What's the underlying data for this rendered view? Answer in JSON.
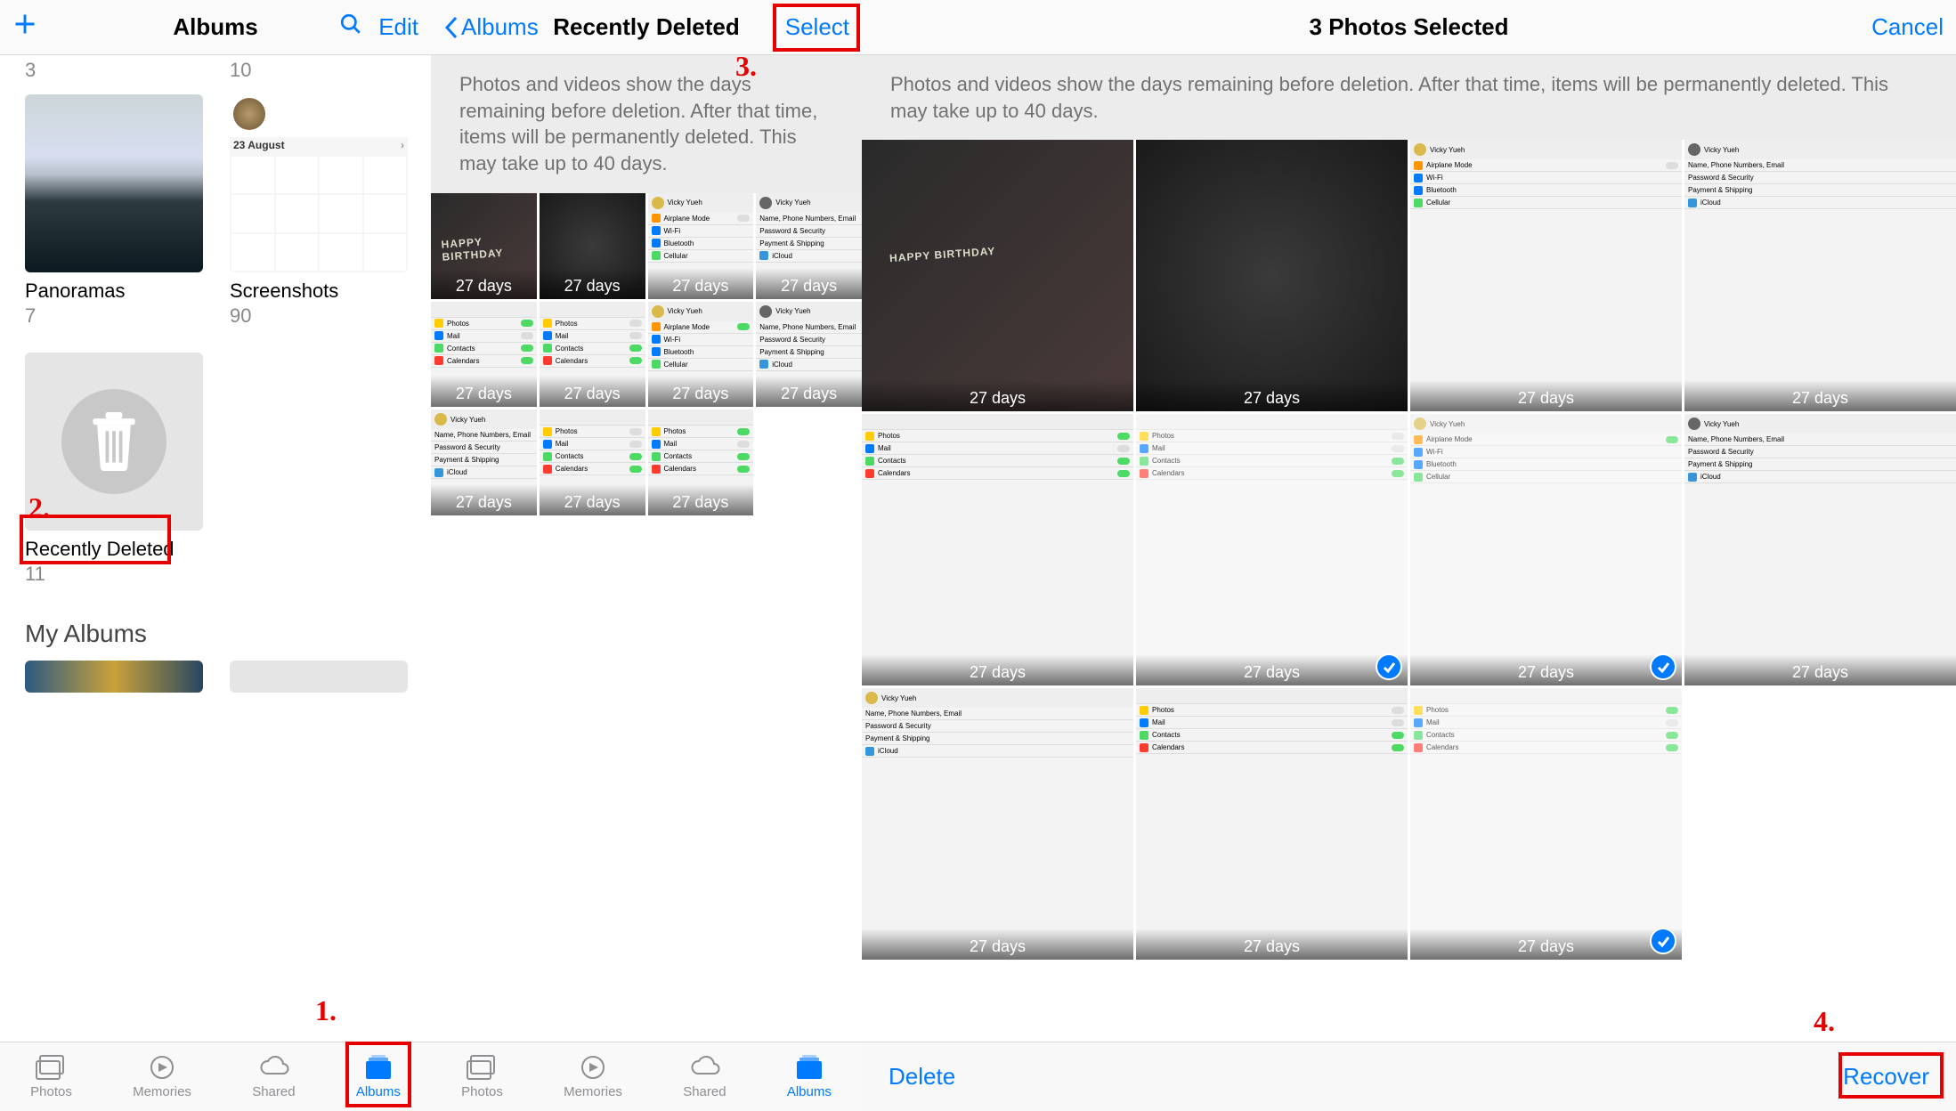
{
  "annotations": {
    "step1": "1.",
    "step2": "2.",
    "step3": "3.",
    "step4": "4."
  },
  "screen1": {
    "nav_title": "Albums",
    "edit": "Edit",
    "top_count_left": "3",
    "top_count_right": "10",
    "ss_date": "23 August",
    "albums": {
      "panoramas": {
        "name": "Panoramas",
        "count": "7"
      },
      "screenshots": {
        "name": "Screenshots",
        "count": "90"
      },
      "recently_deleted": {
        "name": "Recently Deleted",
        "count": "11"
      }
    },
    "section_my_albums": "My Albums",
    "tabs": {
      "photos": "Photos",
      "memories": "Memories",
      "shared": "Shared",
      "albums": "Albums"
    }
  },
  "screen2": {
    "back_label": "Albums",
    "nav_title": "Recently Deleted",
    "select": "Select",
    "info": "Photos and videos show the days remaining before deletion. After that time, items will be permanently deleted. This may take up to 40 days.",
    "days": "27 days",
    "user_name": "Vicky Yueh",
    "tabs": {
      "photos": "Photos",
      "memories": "Memories",
      "shared": "Shared",
      "albums": "Albums"
    }
  },
  "screen3": {
    "nav_title": "3 Photos Selected",
    "cancel": "Cancel",
    "info": "Photos and videos show the days remaining before deletion. After that time, items will be permanently deleted. This may take up to 40 days.",
    "days": "27 days",
    "delete": "Delete",
    "recover": "Recover"
  }
}
